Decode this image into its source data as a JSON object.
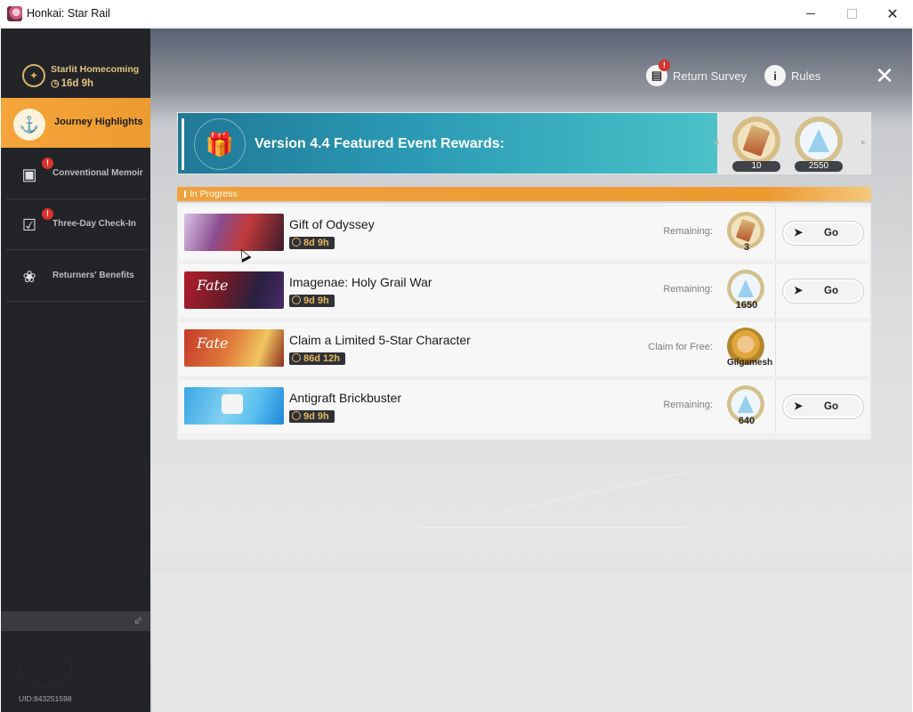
{
  "window": {
    "title": "Honkai: Star Rail",
    "minimize": "",
    "maximize": "",
    "close": "✕"
  },
  "sidebar": {
    "event": {
      "name": "Starlit Homecoming",
      "time": "16d 9h"
    },
    "items": [
      {
        "label": "Journey Highlights",
        "icon": "spinning-top-icon",
        "active": true,
        "badge": ""
      },
      {
        "label": "Conventional Memoir",
        "icon": "memoir-card-icon",
        "active": false,
        "badge": "!"
      },
      {
        "label": "Three-Day Check-In",
        "icon": "calendar-check-icon",
        "active": false,
        "badge": "!"
      },
      {
        "label": "Returners' Benefits",
        "icon": "hands-star-icon",
        "active": false,
        "badge": ""
      }
    ],
    "uid": "UID:843251598"
  },
  "top": {
    "survey": {
      "label": "Return Survey",
      "badge": "!"
    },
    "rules": {
      "label": "Rules",
      "glyph": "i"
    },
    "close": "✕"
  },
  "banner": {
    "title": "Version 4.4 Featured Event Rewards:",
    "rewards": [
      {
        "icon": "star-rail-pass-icon",
        "count": "10"
      },
      {
        "icon": "stellar-jade-icon",
        "count": "2550"
      }
    ]
  },
  "section": {
    "label": "In Progress"
  },
  "events": [
    {
      "name": "Gift of Odyssey",
      "time": "8d 9h",
      "status": "Remaining:",
      "reward_icon": "star-rail-pass-icon",
      "reward": "3",
      "button": "Go"
    },
    {
      "name": "Imagenae: Holy Grail War",
      "time": "9d 9h",
      "status": "Remaining:",
      "reward_icon": "stellar-jade-icon",
      "reward": "1650",
      "button": "Go",
      "thumb_text": "Fate"
    },
    {
      "name": "Claim a Limited 5-Star Character",
      "time": "86d 12h",
      "status": "Claim for Free:",
      "reward_icon": "gilgamesh-portrait-icon",
      "reward": "Gilgamesh",
      "button": "",
      "thumb_text": "Fate"
    },
    {
      "name": "Antigraft Brickbuster",
      "time": "9d 9h",
      "status": "Remaining:",
      "reward_icon": "stellar-jade-icon",
      "reward": "640",
      "button": "Go"
    }
  ],
  "colors": {
    "accent": "#f0a13a",
    "sidebar": "#222428",
    "badge": "#d8322f",
    "banner": "#2b9bb5"
  }
}
